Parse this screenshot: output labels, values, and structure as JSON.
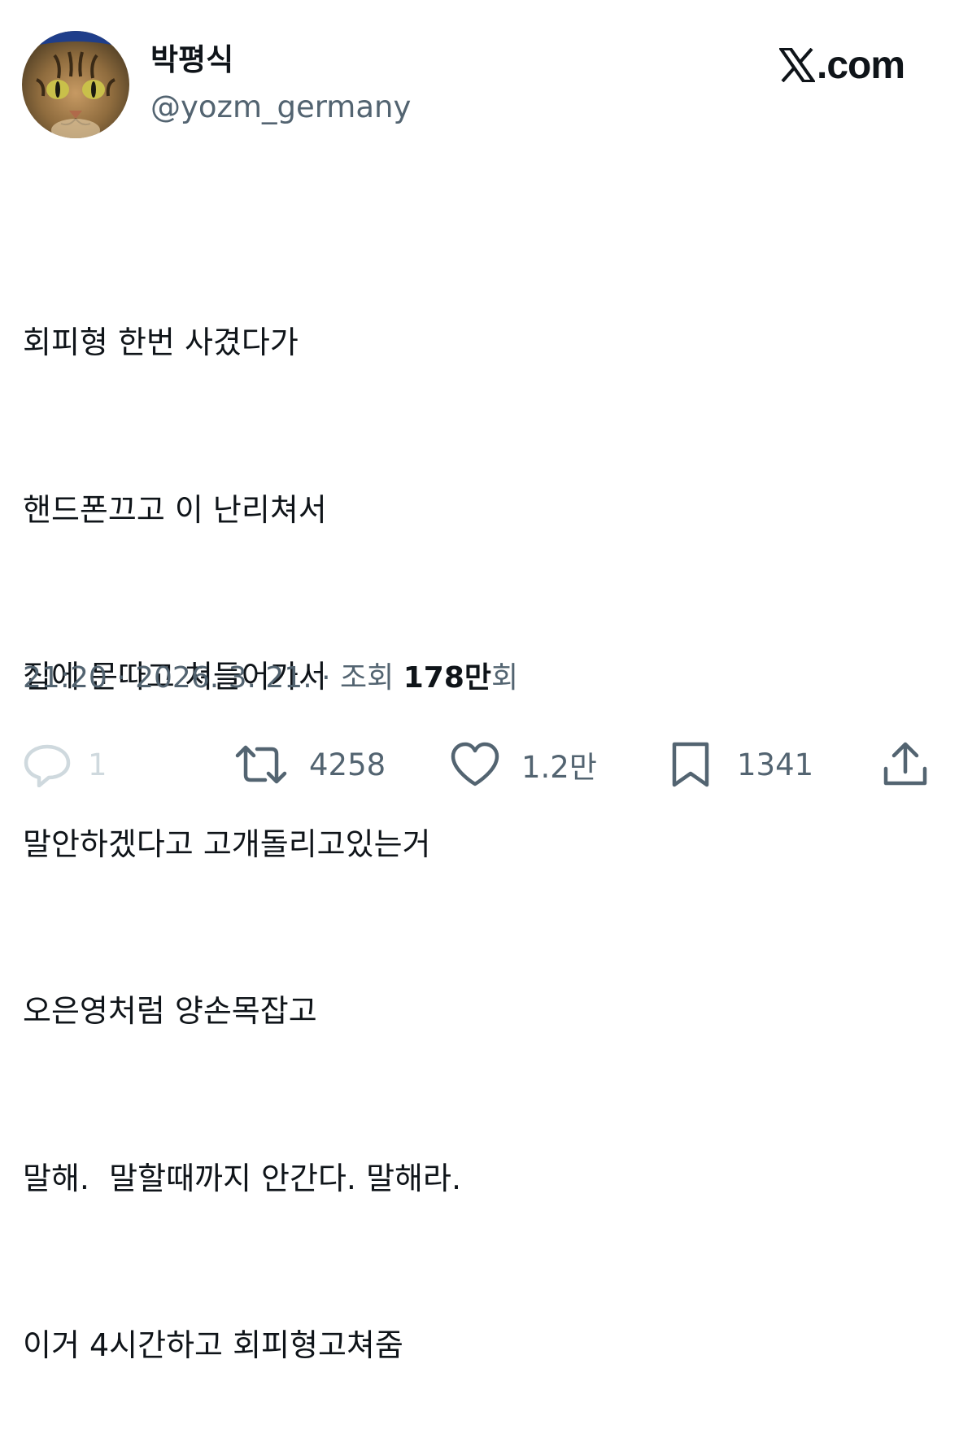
{
  "author": {
    "display_name": "박평식",
    "handle": "@yozm_germany"
  },
  "brand": {
    "logo_mark": "x-logo-icon",
    "logo_suffix": ".com"
  },
  "tweet": {
    "lines": [
      "회피형 한번 사겼다가",
      "핸드폰끄고 이 난리쳐서",
      "집에 문따고 쳐들어가서",
      "말안하겠다고 고개돌리고있는거",
      "오은영처럼 양손목잡고",
      "말해.  말할때까지 안간다. 말해라.",
      "이거 4시간하고 회피형고쳐줌"
    ]
  },
  "meta": {
    "time": "21:20",
    "separator": "·",
    "date": "2026. 3. 21.",
    "views_label": "조회",
    "views_count": "178만",
    "views_suffix": "회"
  },
  "actions": {
    "reply": {
      "icon": "reply-icon",
      "count": "1"
    },
    "retweet": {
      "icon": "retweet-icon",
      "count": "4258"
    },
    "like": {
      "icon": "heart-icon",
      "count": "1.2만"
    },
    "bookmark": {
      "icon": "bookmark-icon",
      "count": "1341"
    },
    "share": {
      "icon": "share-icon"
    }
  },
  "colors": {
    "text_primary": "#0f1419",
    "text_secondary": "#536471",
    "reply_faded": "#cfd9de"
  }
}
